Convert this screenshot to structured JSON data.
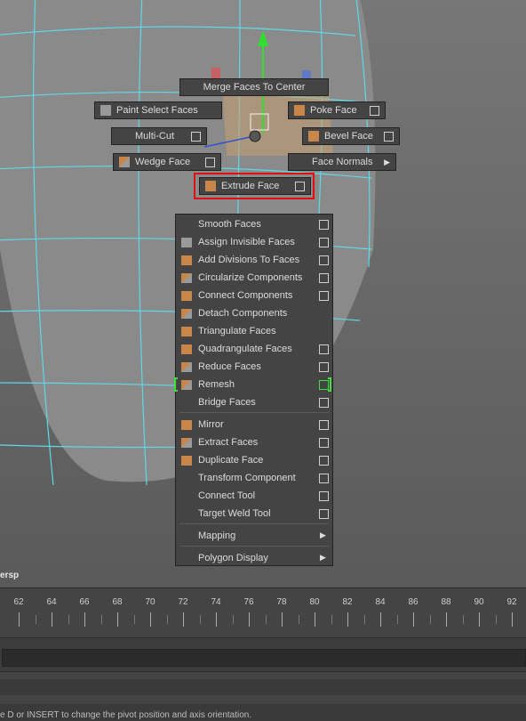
{
  "marking_menu": {
    "north": "Merge Faces To Center",
    "northwest": "Paint Select Faces",
    "northeast": "Poke Face",
    "west": "Multi-Cut",
    "east": "Bevel Face",
    "southwest": "Wedge Face",
    "southeast": "Face Normals",
    "south": "Extrude Face"
  },
  "context_menu": {
    "items": [
      {
        "label": "Smooth Faces"
      },
      {
        "label": "Assign Invisible Faces"
      },
      {
        "label": "Add Divisions To Faces"
      },
      {
        "label": "Circularize Components"
      },
      {
        "label": "Connect Components"
      },
      {
        "label": "Detach Components"
      },
      {
        "label": "Triangulate Faces"
      },
      {
        "label": "Quadrangulate Faces"
      },
      {
        "label": "Reduce Faces"
      },
      {
        "label": "Remesh"
      },
      {
        "label": "Bridge Faces"
      },
      {
        "label": "Mirror"
      },
      {
        "label": "Extract Faces"
      },
      {
        "label": "Duplicate Face"
      },
      {
        "label": "Transform Component"
      },
      {
        "label": "Connect Tool"
      },
      {
        "label": "Target Weld Tool"
      },
      {
        "label": "Mapping"
      },
      {
        "label": "Polygon Display"
      }
    ]
  },
  "viewport": {
    "camera_label": "ersp"
  },
  "timeline": {
    "ticks": [
      "62",
      "64",
      "66",
      "68",
      "70",
      "72",
      "74",
      "76",
      "78",
      "80",
      "82",
      "84",
      "86",
      "88",
      "90",
      "92"
    ]
  },
  "help_line": "e D or INSERT to change the pivot position and axis orientation.",
  "colors": {
    "wireframe": "#5fd8e8",
    "highlight": "#e01010",
    "hotbox_bracket": "#3ee03e",
    "menu_bg": "#444444"
  }
}
